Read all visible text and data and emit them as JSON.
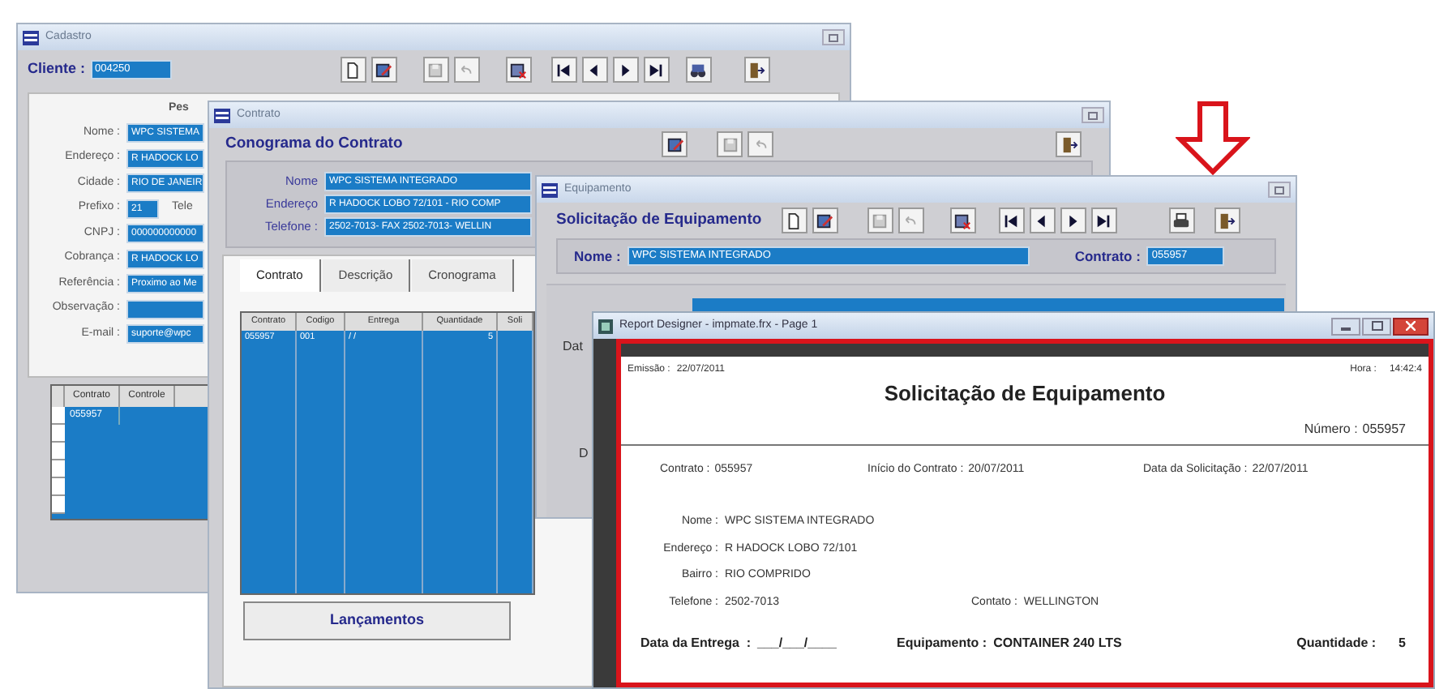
{
  "cadastro": {
    "title": "Cadastro",
    "cliente_label": "Cliente :",
    "cliente_value": "004250",
    "section_label": "Pes",
    "fields": [
      {
        "label": "Nome :",
        "value": "WPC SISTEMA"
      },
      {
        "label": "Endereço :",
        "value": "R HADOCK LO"
      },
      {
        "label": "Cidade :",
        "value": "RIO DE JANEIR"
      },
      {
        "label": "Prefixo :",
        "value": "21",
        "extra": "Tele"
      },
      {
        "label": "CNPJ :",
        "value": "000000000000"
      },
      {
        "label": "Cobrança :",
        "value": "R HADOCK LO"
      },
      {
        "label": "Referência :",
        "value": "Proximo ao Me"
      },
      {
        "label": "Observação :"
      },
      {
        "label": "E-mail :",
        "value": "suporte@wpc"
      }
    ],
    "grid": {
      "columns": [
        "Contrato",
        "Controle"
      ],
      "rows": [
        [
          "055957"
        ]
      ]
    }
  },
  "contrato": {
    "title": "Contrato",
    "heading": "Conograma do Contrato",
    "fields": [
      {
        "label": "Nome",
        "value": "WPC SISTEMA INTEGRADO"
      },
      {
        "label": "Endereço",
        "value": "R HADOCK LOBO 72/101 - RIO COMP"
      },
      {
        "label": "Telefone :",
        "value": "2502-7013- FAX 2502-7013- WELLIN"
      }
    ],
    "tabs": [
      {
        "label": "Contrato",
        "selected": true
      },
      {
        "label": "Descrição",
        "selected": false
      },
      {
        "label": "Cronograma",
        "selected": false
      }
    ],
    "grid": {
      "columns": [
        "Contrato",
        "Codigo",
        "Entrega",
        "Quantidade",
        "Soli"
      ],
      "rows": [
        [
          "055957",
          "001",
          "/ /",
          "5"
        ]
      ]
    },
    "button": "Lançamentos"
  },
  "equipamento": {
    "title": "Equipamento",
    "heading": "Solicitação de Equipamento",
    "nome_label": "Nome :",
    "nome_value": "WPC SISTEMA INTEGRADO",
    "contrato_label": "Contrato :",
    "contrato_value": "055957",
    "labels": [
      "Dat",
      "D"
    ]
  },
  "report": {
    "title": "Report Designer - impmate.frx - Page 1",
    "emissao_label": "Emissão :",
    "emissao_value": "22/07/2011",
    "hora_label": "Hora :",
    "hora_value": "14:42:4",
    "heading": "Solicitação de Equipamento",
    "numero_label": "Número :",
    "numero_value": "055957",
    "top_row": [
      {
        "label": "Contrato :",
        "value": "055957"
      },
      {
        "label": "Início do Contrato :",
        "value": "20/07/2011"
      },
      {
        "label": "Data da Solicitação :",
        "value": "22/07/2011"
      }
    ],
    "details": [
      {
        "label": "Nome :",
        "value": "WPC SISTEMA INTEGRADO"
      },
      {
        "label": "Endereço :",
        "value": "R HADOCK LOBO 72/101"
      },
      {
        "label": "Bairro :",
        "value": "RIO COMPRIDO"
      },
      {
        "label": "Telefone :",
        "value": "2502-7013",
        "contact_label": "Contato :",
        "contact_value": "WELLINGTON"
      }
    ],
    "bottom_row": [
      {
        "label": "Data da Entrega  :",
        "value": "___/___/____"
      },
      {
        "label": "Equipamento :",
        "value": "CONTAINER 240 LTS"
      },
      {
        "label": "Quantidade :",
        "value": "5"
      }
    ]
  }
}
